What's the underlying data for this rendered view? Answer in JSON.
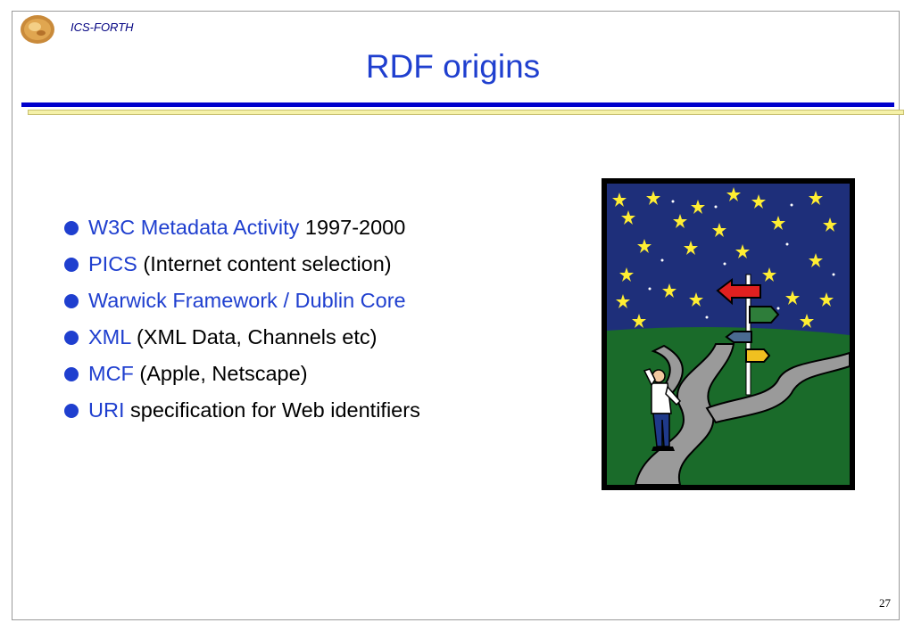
{
  "header": {
    "org": "ICS-FORTH",
    "title": "RDF origins"
  },
  "bullets": [
    {
      "highlight": "W3C Metadata Activity",
      "rest": " 1997-2000"
    },
    {
      "highlight": "PICS",
      "rest": " (Internet content selection)"
    },
    {
      "highlight": "Warwick Framework / Dublin Core",
      "rest": ""
    },
    {
      "highlight": "XML",
      "rest": " (XML Data, Channels etc)"
    },
    {
      "highlight": "MCF",
      "rest": " (Apple, Netscape)"
    },
    {
      "highlight": "URI",
      "rest": " specification for Web identifiers"
    }
  ],
  "footer": {
    "page_number": "27"
  },
  "colors": {
    "accent_blue": "#1f3fcf",
    "rule_blue": "#0000cc",
    "rule_yellow": "#f5f1a8",
    "sky": "#1e2f7a",
    "grass": "#1a6b2a"
  },
  "icons": {
    "logo": "ics-forth-logo-icon",
    "illustration": "crossroads-signpost-clipart"
  }
}
